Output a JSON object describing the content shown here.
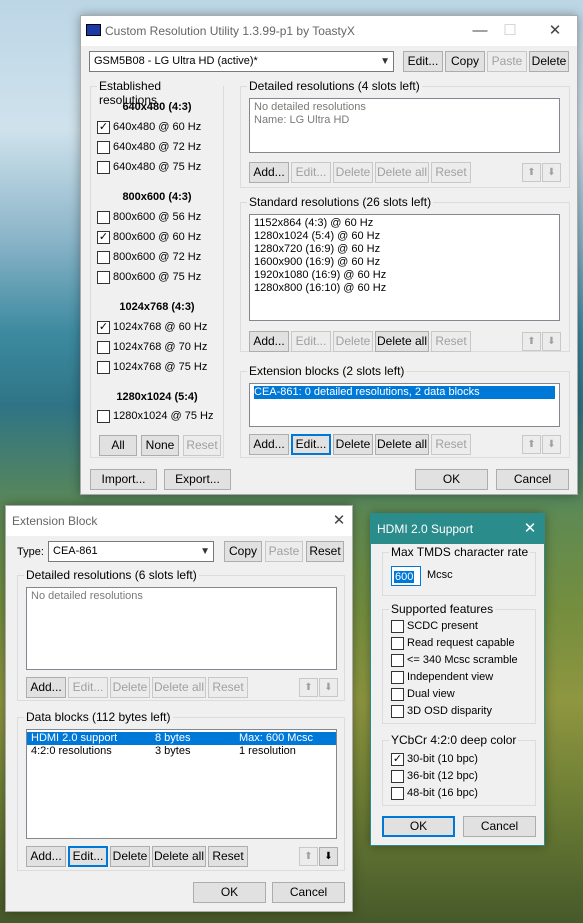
{
  "main": {
    "title": "Custom Resolution Utility 1.3.99-p1 by ToastyX",
    "window_controls": [
      "—",
      "☐",
      "✕"
    ],
    "monitor": "GSM5B08 - LG Ultra HD (active)*",
    "top_buttons": {
      "edit": "Edit...",
      "copy": "Copy",
      "paste": "Paste",
      "delete": "Delete"
    },
    "established": {
      "label": "Established resolutions",
      "groups": [
        {
          "header": "640x480 (4:3)",
          "items": [
            {
              "label": "640x480 @ 60 Hz",
              "checked": true
            },
            {
              "label": "640x480 @ 72 Hz",
              "checked": false
            },
            {
              "label": "640x480 @ 75 Hz",
              "checked": false
            }
          ]
        },
        {
          "header": "800x600 (4:3)",
          "items": [
            {
              "label": "800x600 @ 56 Hz",
              "checked": false
            },
            {
              "label": "800x600 @ 60 Hz",
              "checked": true
            },
            {
              "label": "800x600 @ 72 Hz",
              "checked": false
            },
            {
              "label": "800x600 @ 75 Hz",
              "checked": false
            }
          ]
        },
        {
          "header": "1024x768 (4:3)",
          "items": [
            {
              "label": "1024x768 @ 60 Hz",
              "checked": true
            },
            {
              "label": "1024x768 @ 70 Hz",
              "checked": false
            },
            {
              "label": "1024x768 @ 75 Hz",
              "checked": false
            }
          ]
        },
        {
          "header": "1280x1024 (5:4)",
          "items": [
            {
              "label": "1280x1024 @ 75 Hz",
              "checked": false
            }
          ]
        }
      ],
      "all": "All",
      "none": "None",
      "reset": "Reset"
    },
    "detailed": {
      "label": "Detailed resolutions (4 slots left)",
      "lines": [
        "No detailed resolutions",
        "Name: LG Ultra HD"
      ]
    },
    "standard": {
      "label": "Standard resolutions (26 slots left)",
      "lines": [
        "1152x864 (4:3) @ 60 Hz",
        "1280x1024 (5:4) @ 60 Hz",
        "1280x720 (16:9) @ 60 Hz",
        "1600x900 (16:9) @ 60 Hz",
        "1920x1080 (16:9) @ 60 Hz",
        "1280x800 (16:10) @ 60 Hz"
      ]
    },
    "extension": {
      "label": "Extension blocks (2 slots left)",
      "lines": [
        "CEA-861: 0 detailed resolutions, 2 data blocks"
      ]
    },
    "list_buttons": {
      "add": "Add...",
      "edit": "Edit...",
      "delete": "Delete",
      "delete_all": "Delete all",
      "reset": "Reset"
    },
    "import": "Import...",
    "export": "Export...",
    "ok": "OK",
    "cancel": "Cancel"
  },
  "ext": {
    "title": "Extension Block",
    "close": "✕",
    "type_label": "Type:",
    "type_value": "CEA-861",
    "copy": "Copy",
    "paste": "Paste",
    "reset": "Reset",
    "detailed": {
      "label": "Detailed resolutions (6 slots left)",
      "lines": [
        "No detailed resolutions"
      ]
    },
    "data_blocks": {
      "label": "Data blocks (112 bytes left)",
      "rows": [
        [
          "HDMI 2.0 support",
          "8 bytes",
          "Max: 600 Mcsc"
        ],
        [
          "4:2:0 resolutions",
          "3 bytes",
          "1 resolution"
        ]
      ]
    },
    "ok": "OK",
    "cancel": "Cancel"
  },
  "hdmi": {
    "title": "HDMI 2.0 Support",
    "close": "✕",
    "tmds": {
      "label": "Max TMDS character rate",
      "value": "600",
      "unit": "Mcsc"
    },
    "features": {
      "label": "Supported features",
      "items": [
        {
          "label": "SCDC present",
          "checked": false
        },
        {
          "label": "Read request capable",
          "checked": false
        },
        {
          "label": "<= 340 Mcsc scramble",
          "checked": false
        },
        {
          "label": "Independent view",
          "checked": false
        },
        {
          "label": "Dual view",
          "checked": false
        },
        {
          "label": "3D OSD disparity",
          "checked": false
        }
      ]
    },
    "deep": {
      "label": "YCbCr 4:2:0 deep color",
      "items": [
        {
          "label": "30-bit (10 bpc)",
          "checked": true
        },
        {
          "label": "36-bit (12 bpc)",
          "checked": false
        },
        {
          "label": "48-bit (16 bpc)",
          "checked": false
        }
      ]
    },
    "ok": "OK",
    "cancel": "Cancel"
  },
  "arrows": {
    "up": "⬆",
    "down": "⬇"
  }
}
